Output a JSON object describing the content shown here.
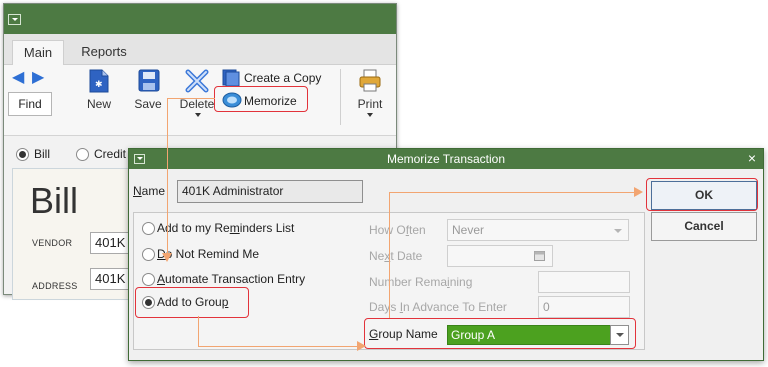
{
  "background_window": {
    "tabs": [
      "Main",
      "Reports"
    ],
    "toolbar": {
      "find": "Find",
      "new": "New",
      "save": "Save",
      "delete": "Delete",
      "create_copy": "Create a Copy",
      "memorize": "Memorize",
      "print": "Print"
    },
    "form": {
      "bill_radio": "Bill",
      "credit_radio": "Credit",
      "title": "Bill",
      "vendor_label": "VENDOR",
      "address_label": "ADDRESS",
      "vendor_value": "401K",
      "address_value": "401K"
    }
  },
  "dialog": {
    "title": "Memorize Transaction",
    "close": "×",
    "name_label": "Name",
    "name_value": "401K Administrator",
    "options": [
      {
        "label": "Add to my Reminders List",
        "selected": false
      },
      {
        "label": "Do Not Remind Me",
        "selected": false
      },
      {
        "label": "Automate Transaction Entry",
        "selected": false
      },
      {
        "label": "Add to Group",
        "selected": true
      }
    ],
    "how_often_label": "How Often",
    "how_often_value": "Never",
    "next_date_label": "Next Date",
    "number_remaining_label": "Number Remaining",
    "days_in_advance_label": "Days In Advance To Enter",
    "days_in_advance_value": "0",
    "group_name_label": "Group Name",
    "group_name_value": "Group A",
    "ok": "OK",
    "cancel": "Cancel"
  },
  "colors": {
    "titlebar": "#4d7a43",
    "highlight": "#e2333b",
    "connector": "#f2a571",
    "group_field": "#4ca11f"
  },
  "icons": [
    "back-arrow-icon",
    "forward-arrow-icon",
    "new-document-icon",
    "save-icon",
    "delete-icon",
    "create-copy-icon",
    "memorize-icon",
    "print-icon",
    "calendar-icon",
    "dropdown-arrow-icon",
    "system-menu-icon",
    "close-icon"
  ]
}
